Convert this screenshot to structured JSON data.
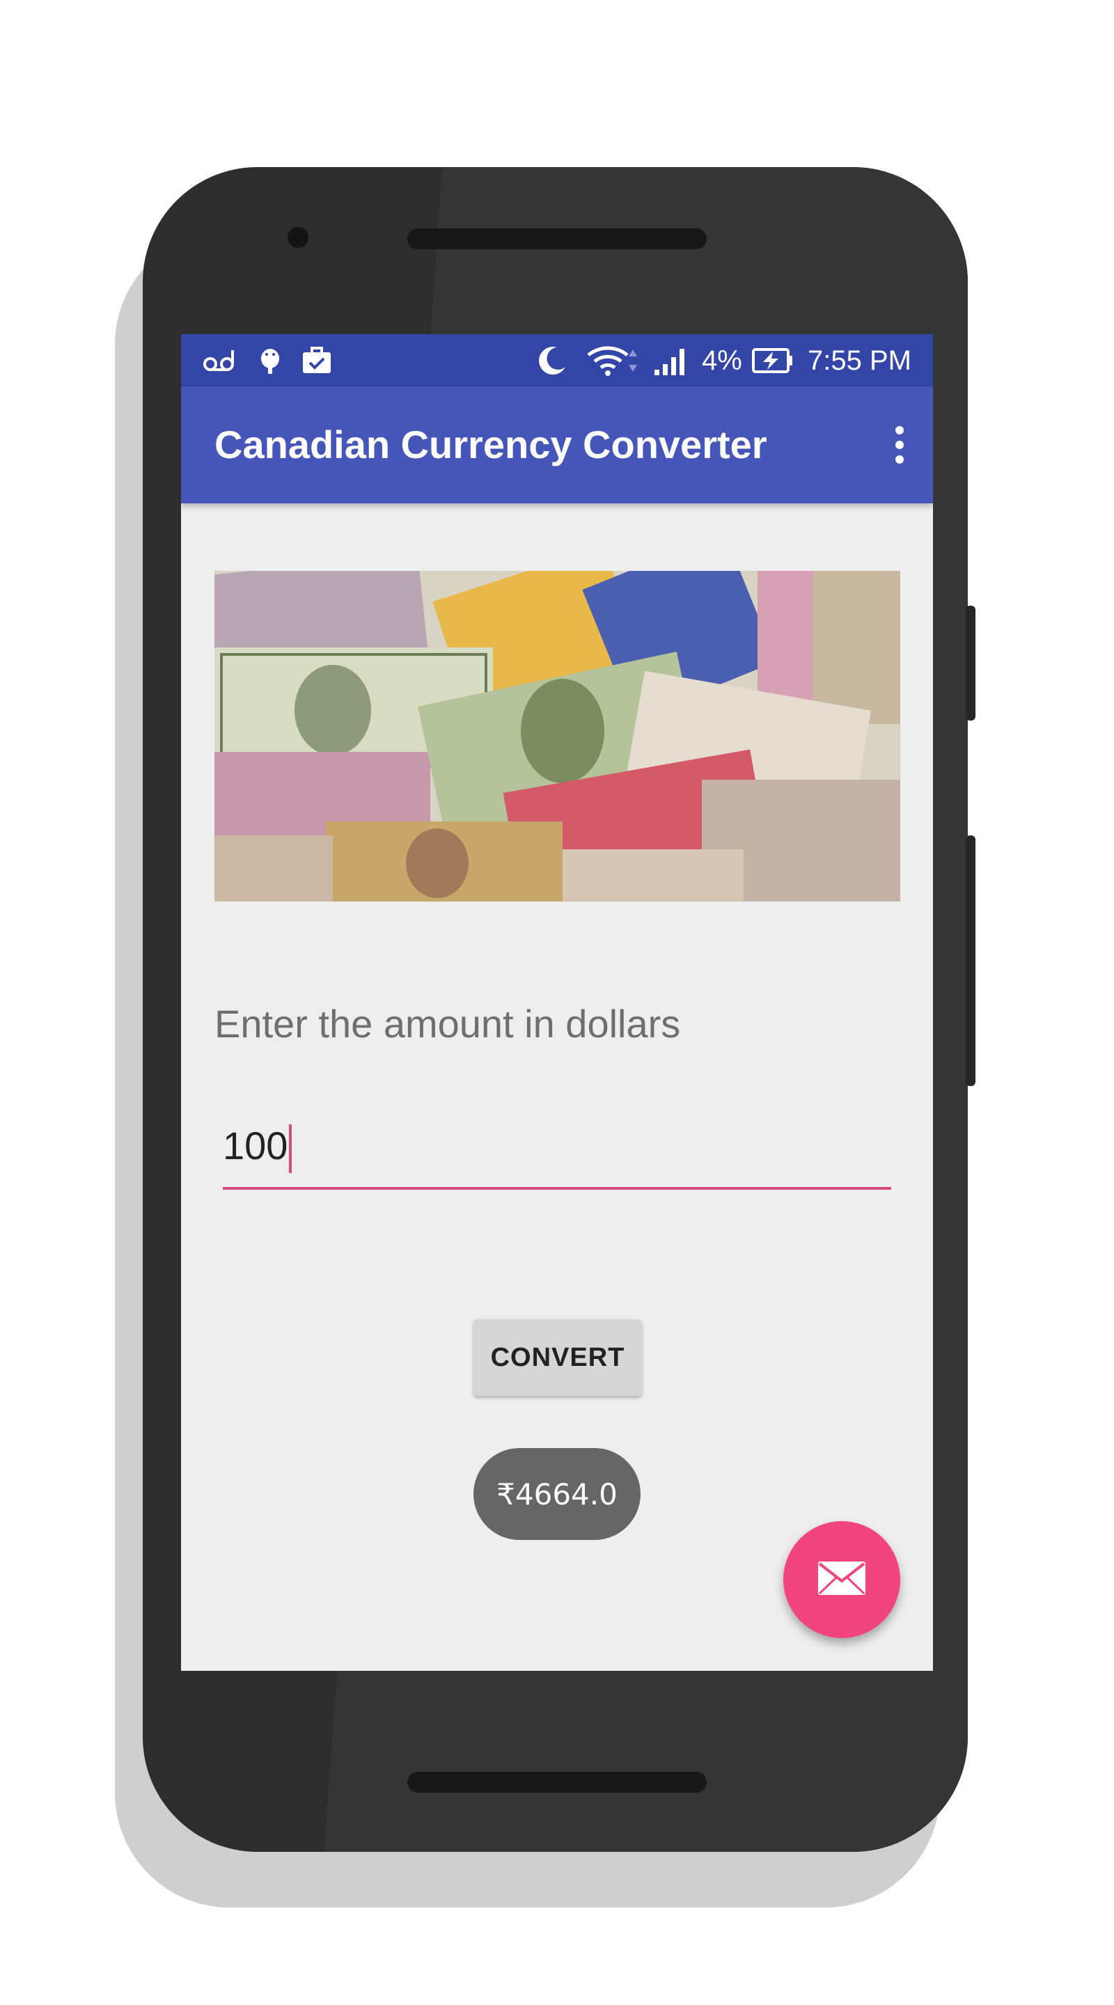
{
  "status_bar": {
    "icons": [
      "voicemail-icon",
      "android-debug-icon",
      "briefcase-check-icon",
      "moon-icon",
      "wifi-icon",
      "signal-icon",
      "battery-charging-icon"
    ],
    "battery_percent": "4%",
    "time": "7:55 PM"
  },
  "app_bar": {
    "title": "Canadian Currency Converter",
    "menu_icon": "more-vert-icon"
  },
  "banner": {
    "image": "world-banknotes-collage"
  },
  "form": {
    "prompt": "Enter the amount in dollars",
    "amount_value": "100",
    "convert_label": "CONVERT"
  },
  "result_toast": {
    "text": "₹4664.0"
  },
  "fab": {
    "icon": "email-icon"
  },
  "colors": {
    "status_bar": "#3345a6",
    "app_bar": "#4556b8",
    "accent": "#f2447f",
    "underline": "#d54c7e",
    "screen_bg": "#eeeeee"
  }
}
